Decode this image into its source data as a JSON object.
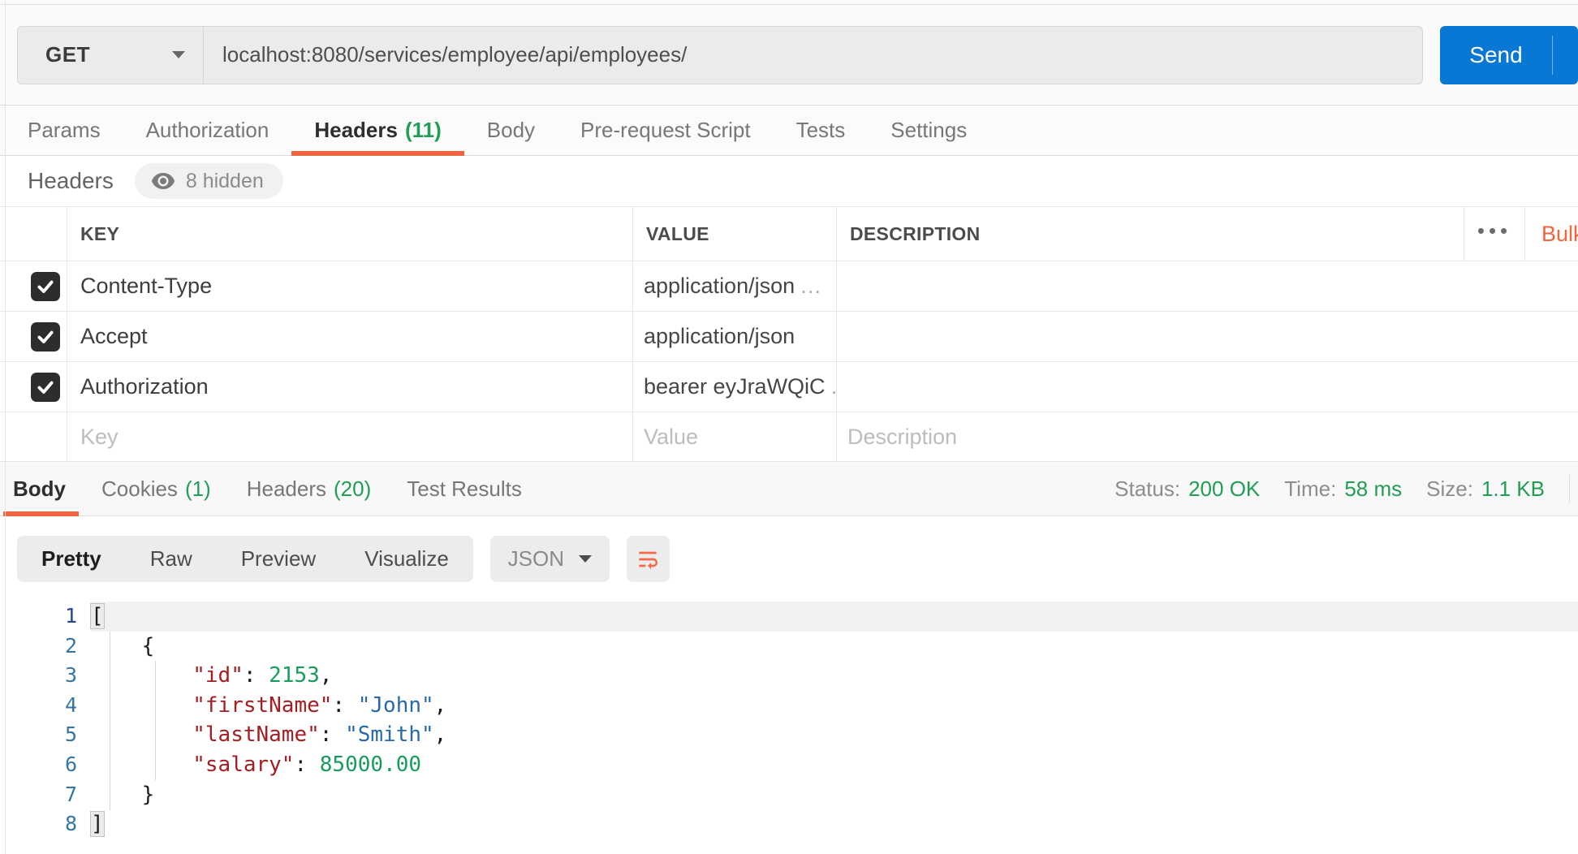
{
  "request": {
    "method": "GET",
    "url": "localhost:8080/services/employee/api/employees/",
    "send_label": "Send"
  },
  "request_tabs": [
    {
      "label": "Params"
    },
    {
      "label": "Authorization"
    },
    {
      "label": "Headers",
      "count": "(11)",
      "active": true
    },
    {
      "label": "Body"
    },
    {
      "label": "Pre-request Script"
    },
    {
      "label": "Tests"
    },
    {
      "label": "Settings"
    }
  ],
  "headers_panel": {
    "title": "Headers",
    "hidden_badge": "8 hidden",
    "bulk_label": "Bulk",
    "columns": {
      "key": "KEY",
      "value": "VALUE",
      "description": "DESCRIPTION"
    },
    "rows": [
      {
        "key": "Content-Type",
        "value": "application/json",
        "ellipsis": "…",
        "checked": true
      },
      {
        "key": "Accept",
        "value": "application/json",
        "ellipsis": "",
        "checked": true
      },
      {
        "key": "Authorization",
        "value": "bearer eyJraWQiC",
        "ellipsis": "…",
        "checked": true
      }
    ],
    "new_row_placeholders": {
      "key": "Key",
      "value": "Value",
      "description": "Description"
    }
  },
  "response": {
    "tabs": [
      {
        "label": "Body",
        "active": true
      },
      {
        "label": "Cookies",
        "count": "(1)"
      },
      {
        "label": "Headers",
        "count": "(20)"
      },
      {
        "label": "Test Results"
      }
    ],
    "status": {
      "label": "Status:",
      "value": "200 OK"
    },
    "time": {
      "label": "Time:",
      "value": "58 ms"
    },
    "size": {
      "label": "Size:",
      "value": "1.1 KB"
    },
    "view_modes": [
      {
        "label": "Pretty",
        "active": true
      },
      {
        "label": "Raw"
      },
      {
        "label": "Preview"
      },
      {
        "label": "Visualize"
      }
    ],
    "language_select": "JSON",
    "code_lines": [
      {
        "n": "1",
        "active": true,
        "tokens": [
          {
            "c": "pm",
            "t": "["
          }
        ]
      },
      {
        "n": "2",
        "tokens": [
          {
            "c": "p",
            "t": "    {"
          }
        ]
      },
      {
        "n": "3",
        "tokens": [
          {
            "c": "ind",
            "t": "        "
          },
          {
            "c": "key",
            "t": "\"id\""
          },
          {
            "c": "p",
            "t": ": "
          },
          {
            "c": "num",
            "t": "2153"
          },
          {
            "c": "p",
            "t": ","
          }
        ]
      },
      {
        "n": "4",
        "tokens": [
          {
            "c": "ind",
            "t": "        "
          },
          {
            "c": "key",
            "t": "\"firstName\""
          },
          {
            "c": "p",
            "t": ": "
          },
          {
            "c": "str",
            "t": "\"John\""
          },
          {
            "c": "p",
            "t": ","
          }
        ]
      },
      {
        "n": "5",
        "tokens": [
          {
            "c": "ind",
            "t": "        "
          },
          {
            "c": "key",
            "t": "\"lastName\""
          },
          {
            "c": "p",
            "t": ": "
          },
          {
            "c": "str",
            "t": "\"Smith\""
          },
          {
            "c": "p",
            "t": ","
          }
        ]
      },
      {
        "n": "6",
        "tokens": [
          {
            "c": "ind",
            "t": "        "
          },
          {
            "c": "key",
            "t": "\"salary\""
          },
          {
            "c": "p",
            "t": ": "
          },
          {
            "c": "num",
            "t": "85000.00"
          }
        ]
      },
      {
        "n": "7",
        "tokens": [
          {
            "c": "p",
            "t": "    }"
          }
        ]
      },
      {
        "n": "8",
        "tokens": [
          {
            "c": "pm",
            "t": "]"
          }
        ]
      }
    ]
  },
  "icons": {
    "more_options": "•••"
  },
  "colors": {
    "accent_orange": "#ee6540",
    "send_blue": "#0977d4",
    "success_green": "#219e54",
    "code_key": "#a41e22",
    "code_string": "#2868ad",
    "code_number": "#189c5b"
  }
}
